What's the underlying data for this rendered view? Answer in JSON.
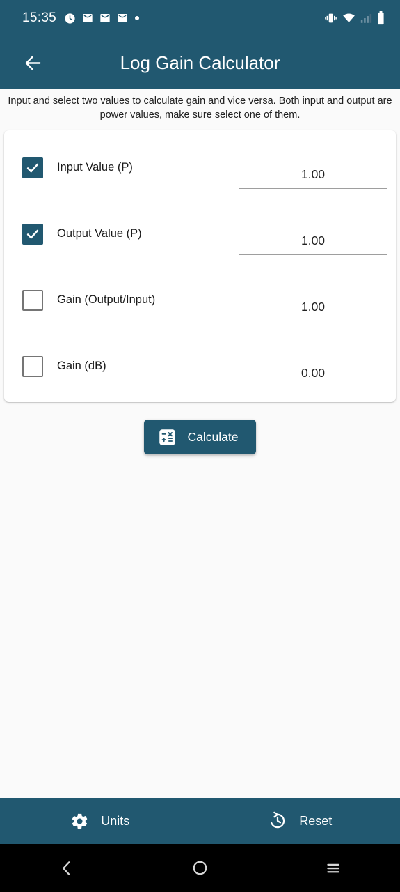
{
  "status_bar": {
    "time": "15:35",
    "left_icons": [
      "alarm-clock-icon",
      "mail-icon",
      "mail-icon",
      "mail-icon",
      "dot-icon"
    ],
    "right_icons": [
      "vibrate-icon",
      "wifi-icon",
      "signal-icon",
      "battery-icon"
    ]
  },
  "app_bar": {
    "back_icon": "back-arrow-icon",
    "title": "Log Gain Calculator"
  },
  "description": "Input and select two values to calculate gain and vice versa. Both input and output are power values, make sure select one of them.",
  "rows": [
    {
      "label": "Input Value (P)",
      "checked": true,
      "value": "1.00"
    },
    {
      "label": "Output Value (P)",
      "checked": true,
      "value": "1.00"
    },
    {
      "label": "Gain (Output/Input)",
      "checked": false,
      "value": "1.00"
    },
    {
      "label": "Gain (dB)",
      "checked": false,
      "value": "0.00"
    }
  ],
  "calculate_button": {
    "label": "Calculate",
    "icon": "calculator-icon"
  },
  "bottom_bar": {
    "units_label": "Units",
    "units_icon": "gear-icon",
    "reset_label": "Reset",
    "reset_icon": "history-restore-icon"
  },
  "android_nav": {
    "back": "nav-back-icon",
    "home": "nav-home-icon",
    "recents": "nav-recents-icon"
  },
  "colors": {
    "primary": "#215870",
    "page_background": "#FAFAFA",
    "card_background": "#FFFFFF",
    "text": "#212121",
    "underline": "#9E9E9E",
    "checkbox_border": "#757575"
  }
}
